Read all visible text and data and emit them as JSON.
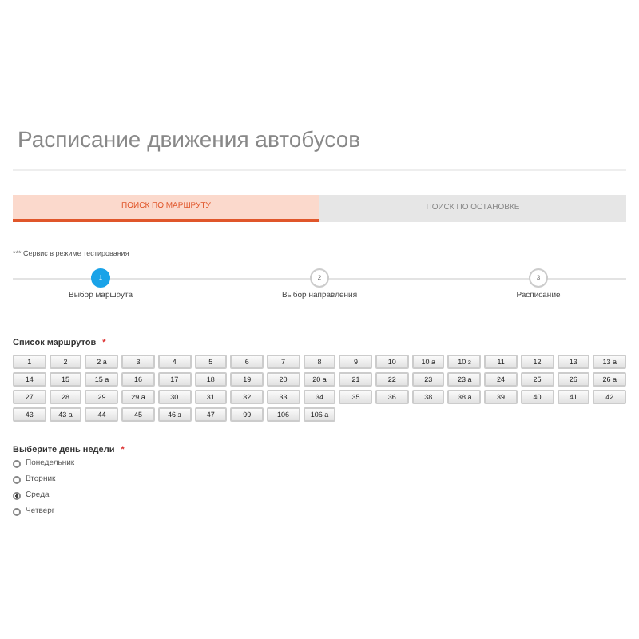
{
  "page_title": "Расписание движения автобусов",
  "tabs": [
    {
      "label": "ПОИСК ПО МАРШРУТУ",
      "selected": true
    },
    {
      "label": "ПОИСК ПО ОСТАНОВКЕ",
      "selected": false
    }
  ],
  "notice": "*** Сервис в режиме тестирования",
  "steps": [
    {
      "number": "1",
      "label": "Выбор маршрута",
      "selected": true
    },
    {
      "number": "2",
      "label": "Выбор направления",
      "selected": false
    },
    {
      "number": "3",
      "label": "Расписание",
      "selected": false
    }
  ],
  "routes": {
    "label": "Список маршрутов",
    "required_mark": "*",
    "items": [
      "1",
      "2",
      "2 а",
      "3",
      "4",
      "5",
      "6",
      "7",
      "8",
      "9",
      "10",
      "10 а",
      "10 з",
      "11",
      "12",
      "13",
      "13 а",
      "14",
      "15",
      "15 а",
      "16",
      "17",
      "18",
      "19",
      "20",
      "20 а",
      "21",
      "22",
      "23",
      "23 а",
      "24",
      "25",
      "26",
      "26 а",
      "27",
      "28",
      "29",
      "29 а",
      "30",
      "31",
      "32",
      "33",
      "34",
      "35",
      "36",
      "38",
      "38 а",
      "39",
      "40",
      "41",
      "42",
      "43",
      "43 а",
      "44",
      "45",
      "46 з",
      "47",
      "99",
      "106",
      "106 а"
    ]
  },
  "weekday": {
    "label": "Выберите день недели",
    "required_mark": "*",
    "options": [
      {
        "label": "Понедельник",
        "selected": false
      },
      {
        "label": "Вторник",
        "selected": false
      },
      {
        "label": "Среда",
        "selected": true
      },
      {
        "label": "Четверг",
        "selected": false
      }
    ]
  }
}
